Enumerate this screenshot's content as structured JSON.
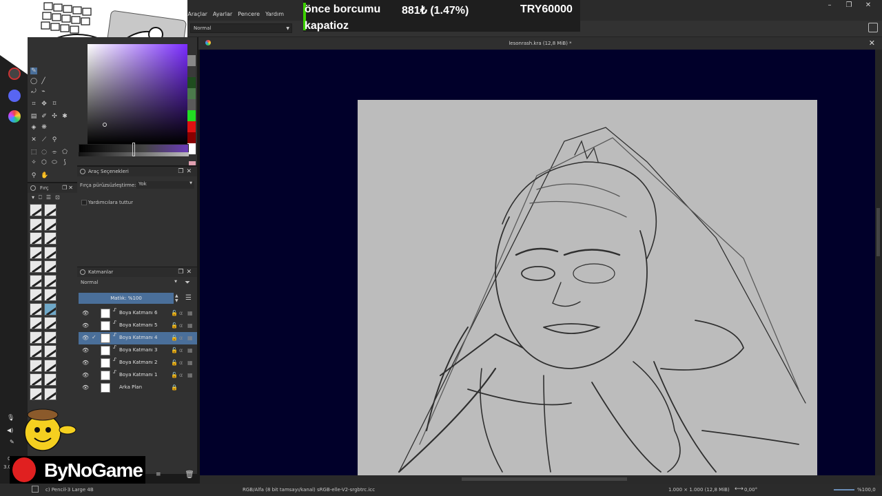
{
  "menu": {
    "items": [
      "Araçlar",
      "Ayarlar",
      "Pencere",
      "Yardım"
    ],
    "partial_left": "ç"
  },
  "ticker": {
    "line1_left": "önce borcumu",
    "line1_mid": "881₺ (1.47%)",
    "line1_right": "TRY60000",
    "line2": "kapatioz"
  },
  "toolbar": {
    "blend_mode": "Normal"
  },
  "document": {
    "title": "lesonrash.kra (12,8 MiB) *"
  },
  "tool_options": {
    "title": "Araç Seçenekleri",
    "smoothing_label": "Fırça pürüzsüzleştirme:",
    "smoothing_value": "Yok",
    "assist_label": "Yardımcılara tuttur"
  },
  "brushes": {
    "title": "Fırç"
  },
  "layers": {
    "title": "Katmanlar",
    "blend_mode": "Normal",
    "opacity": "Matlık: %100",
    "items": [
      {
        "name": "Boya Katmanı 6",
        "selected": false,
        "checked": false
      },
      {
        "name": "Boya Katmanı 5",
        "selected": false,
        "checked": false
      },
      {
        "name": "Boya Katmanı 4",
        "selected": true,
        "checked": true
      },
      {
        "name": "Boya Katmanı 3",
        "selected": false,
        "checked": false
      },
      {
        "name": "Boya Katmanı 2",
        "selected": false,
        "checked": false
      },
      {
        "name": "Boya Katmanı 1",
        "selected": false,
        "checked": false
      },
      {
        "name": "Arka Plan",
        "selected": false,
        "checked": false,
        "locked": true
      }
    ]
  },
  "status": {
    "brush": "c) Pencil-3 Large 4B",
    "color_profile": "RGB/Alfa (8 bit tamsayı/kanal) sRGB-elle-V2-srgbtrc.icc",
    "dimensions": "1.000 × 1.000 (12,8 MiB)",
    "rotation": "0,00°",
    "zoom": "%100,0"
  },
  "overlay": {
    "watermark": "ByNoGame",
    "side_numbers": [
      "0(",
      "3.0("
    ]
  },
  "colors": {
    "canvas_bg": "#01002a",
    "paper": "#bcbcbc",
    "selection": "#4a6f9a",
    "ticker_accent": "#3cd000"
  }
}
